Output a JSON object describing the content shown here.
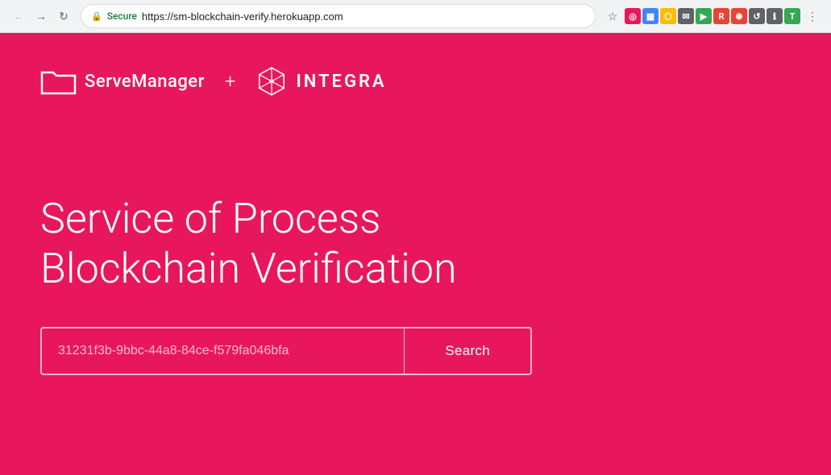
{
  "browser": {
    "url": "https://sm-blockchain-verify.herokuapp.com",
    "secure_label": "Secure",
    "nav": {
      "back_label": "←",
      "forward_label": "→",
      "refresh_label": "↺"
    }
  },
  "header": {
    "serve_manager_label": "ServeManager",
    "plus_label": "+",
    "integra_label": "INTEGRA"
  },
  "main": {
    "heading_line1": "Service of Process",
    "heading_line2": "Blockchain Verification",
    "search": {
      "placeholder": "31231f3b-9bbc-44a8-84ce-f579fa046bfa",
      "button_label": "Search"
    }
  }
}
